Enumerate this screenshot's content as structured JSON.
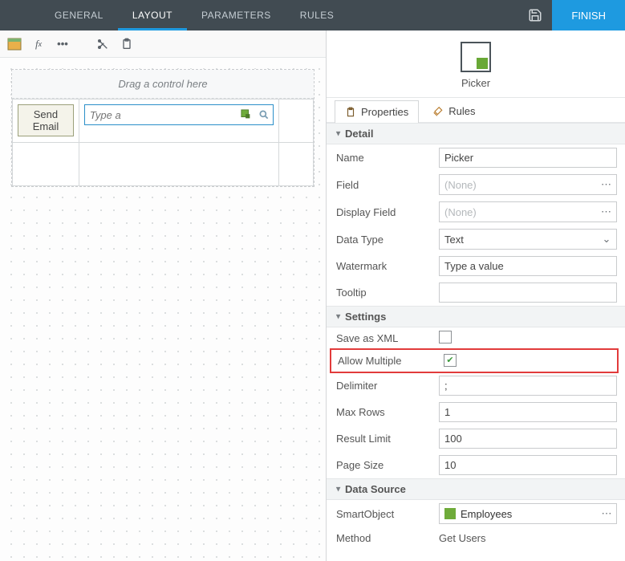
{
  "topbar": {
    "tabs": [
      "GENERAL",
      "LAYOUT",
      "PARAMETERS",
      "RULES"
    ],
    "active_index": 1,
    "finish": "FINISH"
  },
  "canvas": {
    "drop_hint": "Drag a control here",
    "button_label": "Send Email",
    "picker_placeholder": "Type a"
  },
  "picker_panel": {
    "title": "Picker",
    "tabs": {
      "properties": "Properties",
      "rules": "Rules"
    },
    "sections": {
      "detail": "Detail",
      "settings": "Settings",
      "datasource": "Data Source"
    },
    "detail": {
      "name_label": "Name",
      "name_value": "Picker",
      "field_label": "Field",
      "field_value": "(None)",
      "display_field_label": "Display Field",
      "display_field_value": "(None)",
      "data_type_label": "Data Type",
      "data_type_value": "Text",
      "watermark_label": "Watermark",
      "watermark_value": "Type a value",
      "tooltip_label": "Tooltip",
      "tooltip_value": ""
    },
    "settings": {
      "save_xml_label": "Save as XML",
      "save_xml_checked": false,
      "allow_multiple_label": "Allow Multiple",
      "allow_multiple_checked": true,
      "delimiter_label": "Delimiter",
      "delimiter_value": ";",
      "max_rows_label": "Max Rows",
      "max_rows_value": "1",
      "result_limit_label": "Result Limit",
      "result_limit_value": "100",
      "page_size_label": "Page Size",
      "page_size_value": "10"
    },
    "datasource": {
      "smartobject_label": "SmartObject",
      "smartobject_value": "Employees",
      "method_label": "Method",
      "method_value": "Get Users"
    }
  }
}
